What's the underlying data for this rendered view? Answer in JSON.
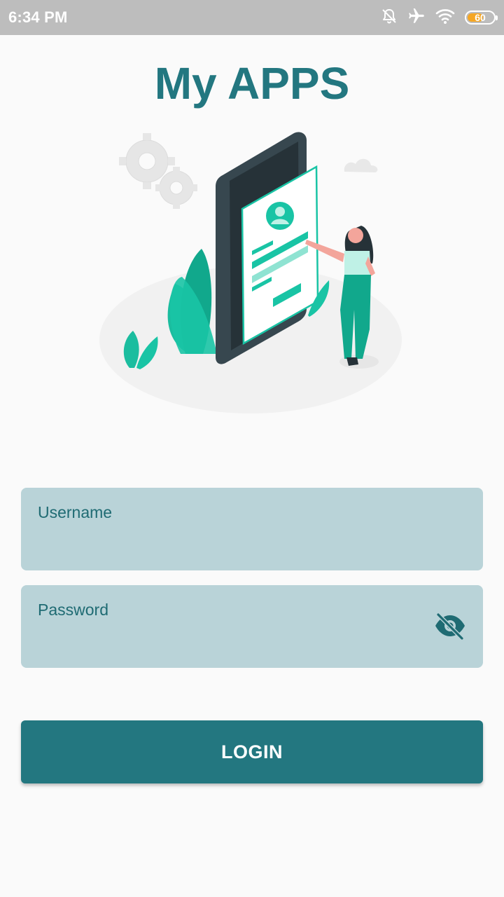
{
  "status_bar": {
    "time": "6:34 PM",
    "icons": [
      "bell-off-icon",
      "airplane-icon",
      "wifi-icon",
      "battery-icon"
    ],
    "battery_level": "60",
    "battery_fraction": 0.6
  },
  "app": {
    "title": "My APPS",
    "accent_color": "#237780",
    "field_color": "#b9d3d8"
  },
  "form": {
    "username_label": "Username",
    "username_value": "",
    "password_label": "Password",
    "password_value": "",
    "password_toggle_icon": "eye-off-icon",
    "login_label": "LOGIN"
  }
}
